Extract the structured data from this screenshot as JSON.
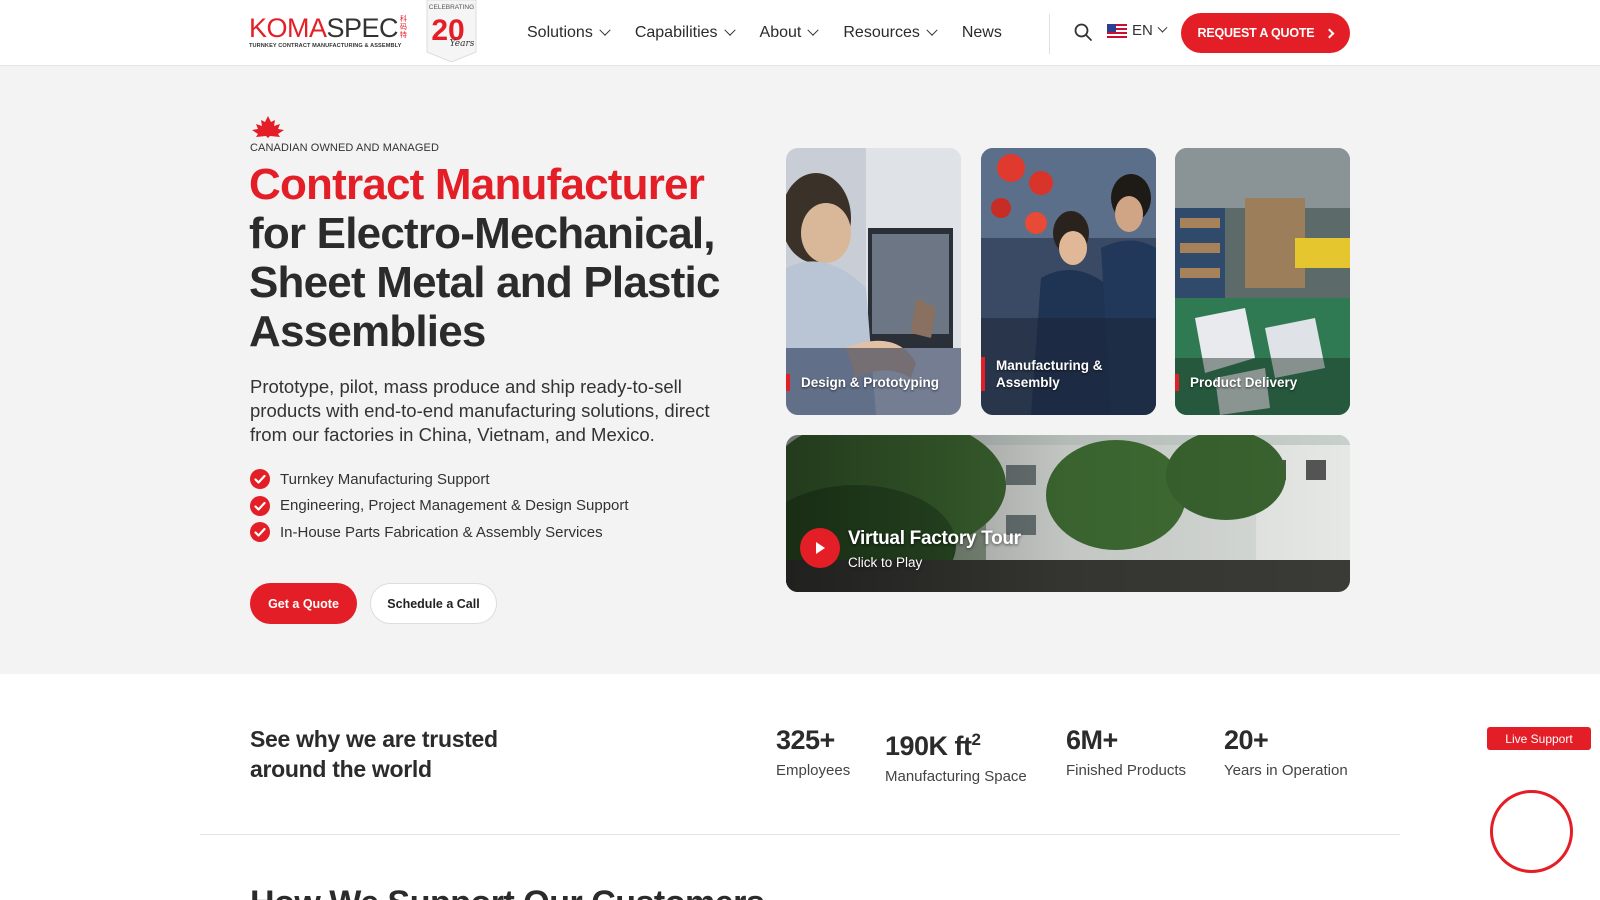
{
  "header": {
    "logo": {
      "text_a": "KOMA",
      "text_b": "SPEC",
      "subtitle": "TURNKEY CONTRACT MANUFACTURING & ASSEMBLY",
      "chinese_mark": "科码特",
      "badge_top": "CELEBRATING",
      "badge_number": "20",
      "badge_script": "Years"
    },
    "nav": [
      {
        "label": "Solutions",
        "dropdown": true
      },
      {
        "label": "Capabilities",
        "dropdown": true
      },
      {
        "label": "About",
        "dropdown": true
      },
      {
        "label": "Resources",
        "dropdown": true
      },
      {
        "label": "News",
        "dropdown": false
      }
    ],
    "search_icon": "search-icon",
    "language": {
      "code": "EN",
      "flag": "us-flag-icon"
    },
    "cta": "REQUEST A QUOTE",
    "accent": "#e41e26"
  },
  "hero": {
    "eyebrow": "CANADIAN OWNED AND MANAGED",
    "headline_red": "Contract Manufacturer",
    "headline_rest": "for Electro-Mechanical, Sheet Metal and Plastic Assemblies",
    "lede": "Prototype, pilot, mass produce and ship ready-to-sell products with end-to-end manufacturing solutions, direct from our factories in China, Vietnam, and Mexico.",
    "checks": [
      "Turnkey Manufacturing Support",
      "Engineering, Project Management & Design Support",
      "In-House Parts Fabrication & Assembly Services"
    ],
    "buttons": {
      "primary": "Get a Quote",
      "secondary": "Schedule a Call"
    },
    "cards": [
      {
        "label": "Design & Prototyping"
      },
      {
        "label": "Manufacturing & Assembly"
      },
      {
        "label": "Product Delivery"
      }
    ],
    "tour": {
      "title": "Virtual Factory Tour",
      "subtitle": "Click to Play"
    }
  },
  "stats": {
    "heading": "See why we are trusted around the world",
    "items": [
      {
        "value": "325+",
        "label": "Employees"
      },
      {
        "value": "190K ft",
        "sup": "2",
        "label": "Manufacturing Space"
      },
      {
        "value": "6M+",
        "label": "Finished Products"
      },
      {
        "value": "20+",
        "label": "Years in Operation"
      }
    ]
  },
  "next_section": {
    "heading": "How We Support Our Customers"
  },
  "widgets": {
    "live_support": "Live Support"
  }
}
